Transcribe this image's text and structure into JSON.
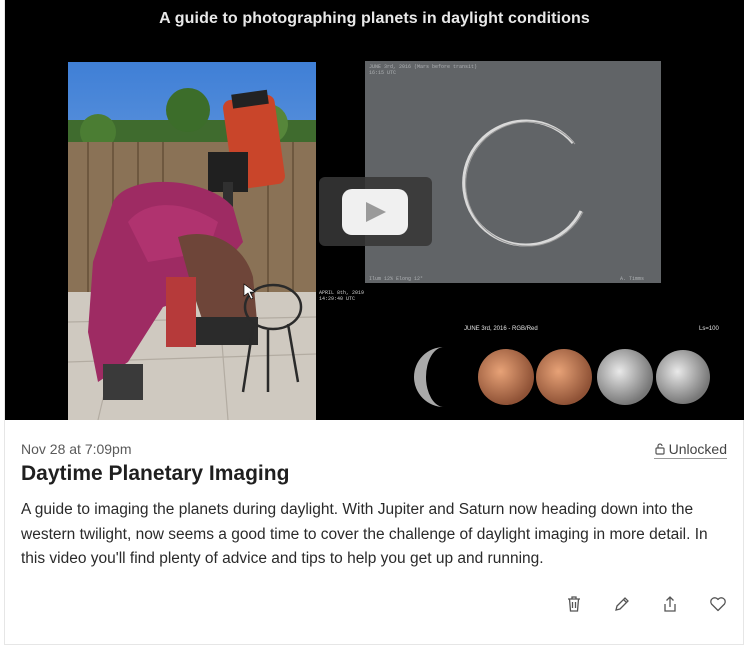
{
  "video": {
    "title": "A guide to photographing planets in daylight conditions",
    "panel_label_top": "JUNE 3rd, 2016 (Mars before transit)",
    "panel_label_time": "16:15 UTC",
    "panel_label_bottom_left": "Ilum 12% Elong 12°",
    "panel_label_bottom_right": "A. Timms",
    "photo_caption_date": "APRIL 8th, 2019",
    "photo_caption_time": "14:29:40 UTC",
    "mars_caption": "JUNE 3rd, 2016 - RGB/Red",
    "ls_label": "Ls=100"
  },
  "post": {
    "timestamp": "Nov 28 at 7:09pm",
    "status": "Unlocked",
    "title": "Daytime Planetary Imaging",
    "description": "A guide to imaging the planets during daylight. With Jupiter and Saturn now heading down into the western twilight, now seems a good time to cover the challenge of daylight imaging in more detail. In this video you'll find plenty of advice and tips to help you get up and running."
  },
  "icons": {
    "play": "play-icon",
    "lock": "unlock-icon",
    "delete": "trash-icon",
    "edit": "pencil-icon",
    "share": "share-icon",
    "like": "heart-icon"
  }
}
